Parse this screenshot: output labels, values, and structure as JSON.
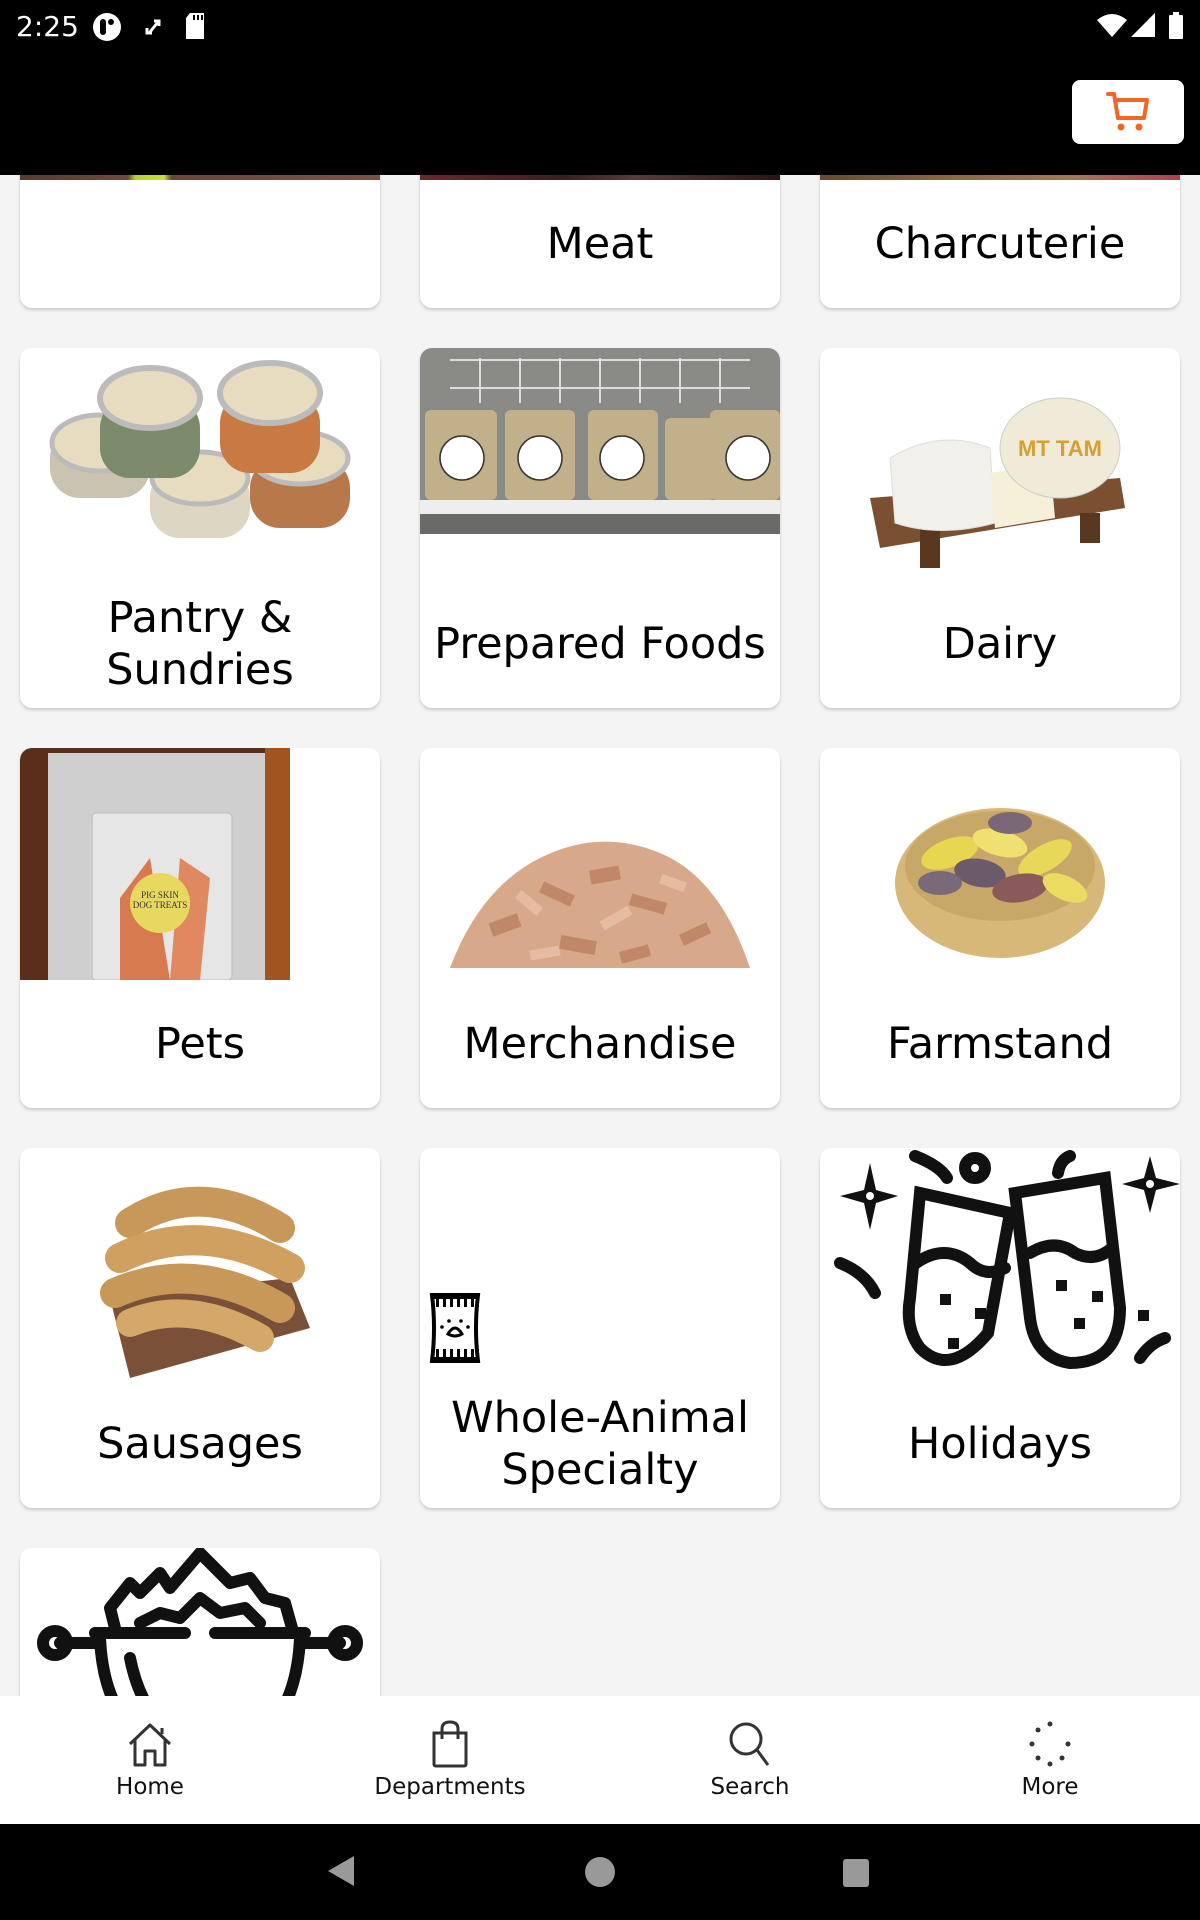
{
  "status_bar": {
    "time": "2:25",
    "left_icons": [
      "app-notification-icon",
      "sync-icon",
      "sd-card-icon"
    ],
    "right_icons": [
      "wifi-icon",
      "signal-icon",
      "battery-icon"
    ]
  },
  "app_bar": {
    "cart_icon": "shopping-cart-icon",
    "accent_color": "#f26522"
  },
  "departments": [
    {
      "label": "",
      "image": "produce-photo"
    },
    {
      "label": "Meat",
      "image": "meat-photo"
    },
    {
      "label": "Charcuterie",
      "image": "charcuterie-photo"
    },
    {
      "label": "Pantry & Sundries",
      "image": "spice-jars-photo"
    },
    {
      "label": "Prepared Foods",
      "image": "bone-broth-containers-photo"
    },
    {
      "label": "Dairy",
      "image": "mt-tam-cheese-photo"
    },
    {
      "label": "Pets",
      "image": "pig-skin-dog-treats-photo"
    },
    {
      "label": "Merchandise",
      "image": "wood-chips-photo"
    },
    {
      "label": "Farmstand",
      "image": "potatoes-basket-photo"
    },
    {
      "label": "Sausages",
      "image": "sausages-photo"
    },
    {
      "label": "Whole-Animal Specialty",
      "image": "pet-food-bag-icon"
    },
    {
      "label": "Holidays",
      "image": "champagne-toast-icon"
    },
    {
      "label": "",
      "image": "grill-bowl-icon"
    }
  ],
  "bottom_nav": [
    {
      "label": "Home",
      "icon": "home-icon"
    },
    {
      "label": "Departments",
      "icon": "shopping-bag-icon"
    },
    {
      "label": "Search",
      "icon": "search-icon"
    },
    {
      "label": "More",
      "icon": "more-dots-icon"
    }
  ],
  "system_nav": [
    "back-icon",
    "home-circle-icon",
    "recents-icon"
  ]
}
